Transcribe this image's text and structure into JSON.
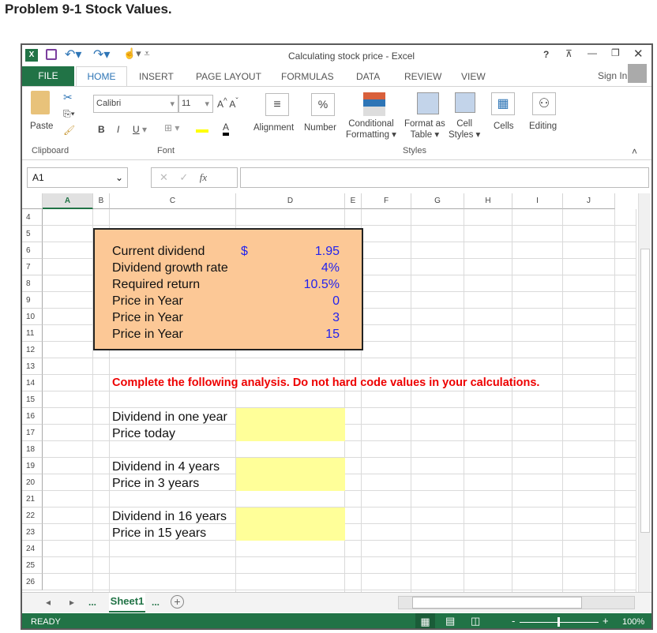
{
  "problem_title": "Problem 9-1 Stock Values.",
  "window": {
    "title": "Calculating stock price - Excel",
    "help": "?",
    "sign_in": "Sign In"
  },
  "tabs": [
    "FILE",
    "HOME",
    "INSERT",
    "PAGE LAYOUT",
    "FORMULAS",
    "DATA",
    "REVIEW",
    "VIEW"
  ],
  "ribbon": {
    "paste": "Paste",
    "font_name": "Calibri",
    "font_size": "11",
    "bold": "B",
    "italic": "I",
    "underline": "U",
    "alignment": "Alignment",
    "number": "Number",
    "percent": "%",
    "conditional": [
      "Conditional",
      "Formatting ▾"
    ],
    "format_table": [
      "Format as",
      "Table ▾"
    ],
    "cell_styles": [
      "Cell",
      "Styles ▾"
    ],
    "cells": "Cells",
    "editing": "Editing",
    "groups": {
      "clipboard": "Clipboard",
      "font": "Font",
      "styles": "Styles"
    }
  },
  "formula_bar": {
    "name_box": "A1",
    "fx": "fx",
    "formula": ""
  },
  "columns": [
    "A",
    "B",
    "C",
    "D",
    "E",
    "F",
    "G",
    "H",
    "I",
    "J"
  ],
  "rows": [
    "4",
    "5",
    "6",
    "7",
    "8",
    "9",
    "10",
    "11",
    "12",
    "13",
    "14",
    "15",
    "16",
    "17",
    "18",
    "19",
    "20",
    "21",
    "22",
    "23",
    "24",
    "25",
    "26"
  ],
  "inputs": [
    {
      "label": "Current dividend",
      "currency": "$",
      "value": "1.95"
    },
    {
      "label": "Dividend growth rate",
      "value": "4%"
    },
    {
      "label": "Required return",
      "value": "10.5%"
    },
    {
      "label": "Price in Year",
      "value": "0"
    },
    {
      "label": "Price in Year",
      "value": "3"
    },
    {
      "label": "Price in Year",
      "value": "15"
    }
  ],
  "instruction": "Complete the following analysis. Do not hard code values in your calculations.",
  "analysis": [
    "Dividend in one year",
    "Price today",
    "Dividend in 4 years",
    "Price in 3 years",
    "Dividend in 16 years",
    "Price in 15 years"
  ],
  "sheet_tabs": {
    "active": "Sheet1",
    "ellipsis": "..."
  },
  "status": {
    "ready": "READY",
    "zoom": "100%"
  },
  "colors": {
    "excel_green": "#217346",
    "input_box": "#fcc896",
    "answer_fill": "#ffff99",
    "value_blue": "#2222ee",
    "instruction_red": "#ee0000"
  }
}
